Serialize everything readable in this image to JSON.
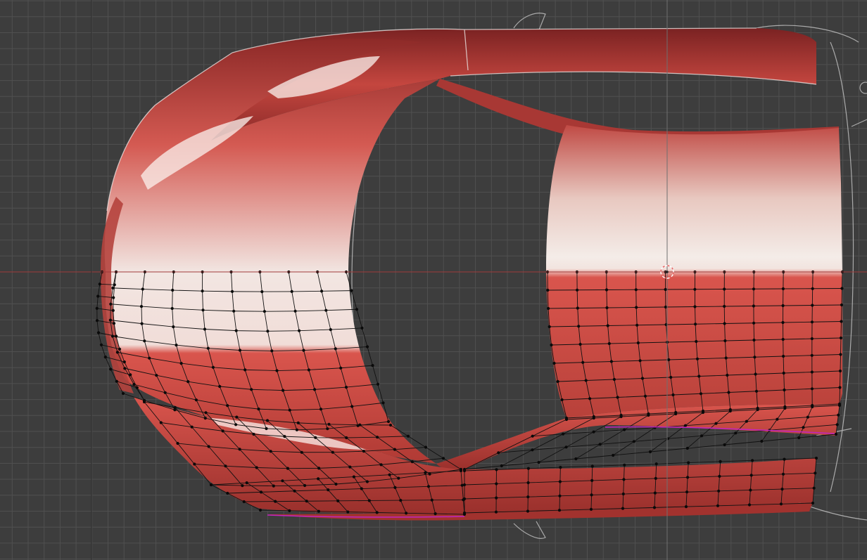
{
  "viewport": {
    "view": "top-orthographic",
    "mode": "edit-mode",
    "background": "#3d3d3d",
    "grid_color": "#505050",
    "grid_major_color": "#2a2a2a",
    "x_axis_color": "#a03a3a",
    "y_axis_color": "#6f6f6f",
    "mesh": {
      "material_color_light": "#f2e6e2",
      "material_color_mid": "#d9554d",
      "material_color_dark": "#8e2a28",
      "wire_color": "#111111",
      "vertex_color": "#0a0a0a",
      "reference_outline_color": "#cfcfcf",
      "seam_color": "#c026c0"
    },
    "cursor_icon": "3d-cursor-icon"
  }
}
